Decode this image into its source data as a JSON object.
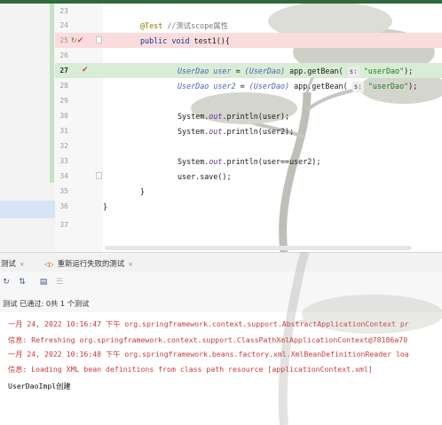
{
  "editor": {
    "lines": [
      {
        "num": "23"
      },
      {
        "num": "24",
        "annotation": "@Test",
        "comment": "//测试scope属性"
      },
      {
        "num": "25",
        "kw_public": "public",
        "kw_void": "void",
        "method": "test1(){"
      },
      {
        "num": "26"
      },
      {
        "num": "27",
        "type": "UserDao",
        "var": "user",
        "eq": "=",
        "cast": "(UserDao)",
        "call": "app.getBean(",
        "hint": "s:",
        "str": "\"userDao\"",
        "end": ");"
      },
      {
        "num": "28",
        "type": "UserDao",
        "var": "user2",
        "eq": "=",
        "cast": "(UserDao)",
        "call": "app.getBean(",
        "hint": "s:",
        "str": "\"userDao\"",
        "end": ");"
      },
      {
        "num": "29"
      },
      {
        "num": "30",
        "pre": "System.",
        "field": "out",
        "post": ".println(user);"
      },
      {
        "num": "31",
        "pre": "System.",
        "field": "out",
        "post": ".println(user2);"
      },
      {
        "num": "32"
      },
      {
        "num": "33",
        "pre": "System.",
        "field": "out",
        "post": ".println(user==user2);"
      },
      {
        "num": "34",
        "text": "user.save();"
      },
      {
        "num": "35",
        "text": "}"
      },
      {
        "num": "36",
        "text": "}"
      },
      {
        "num": "37"
      }
    ]
  },
  "tool_panel": {
    "tabs": [
      {
        "label": "测试",
        "close": "×"
      },
      {
        "label": "重新运行失败的测试",
        "close": "×"
      }
    ],
    "status": "测试 已通过: 0共 1 个测试",
    "console": [
      {
        "text": "一月 24, 2022 10:16:47 下午 org.springframework.context.support.AbstractApplicationContext pr",
        "color": "#c83a3a"
      },
      {
        "text": "信息: Refreshing org.springframework.context.support.ClassPathXmlApplicationContext@78186a70",
        "color": "#c83a3a"
      },
      {
        "text": "一月 24, 2022 10:16:48 下午 org.springframework.beans.factory.xml.XmlBeanDefinitionReader loa",
        "color": "#c83a3a"
      },
      {
        "text": "信息: Loading XML bean definitions from class path resource [applicationContext.xml]",
        "color": "#c83a3a"
      },
      {
        "text": "UserDaoImpl创建",
        "color": "#111111"
      }
    ]
  },
  "icons": {
    "run": "run-gutter-icon",
    "debug": "bug-gutter-icon",
    "toolbar": [
      "rerun-icon",
      "sort-icon",
      "layout-icon",
      "collapse-icon"
    ]
  },
  "colors": {
    "accent_top": "#2e6b3c",
    "error_text": "#c83a3a",
    "line_highlight_red": "#fbdcdc",
    "line_highlight_green": "#d9ecd5"
  }
}
